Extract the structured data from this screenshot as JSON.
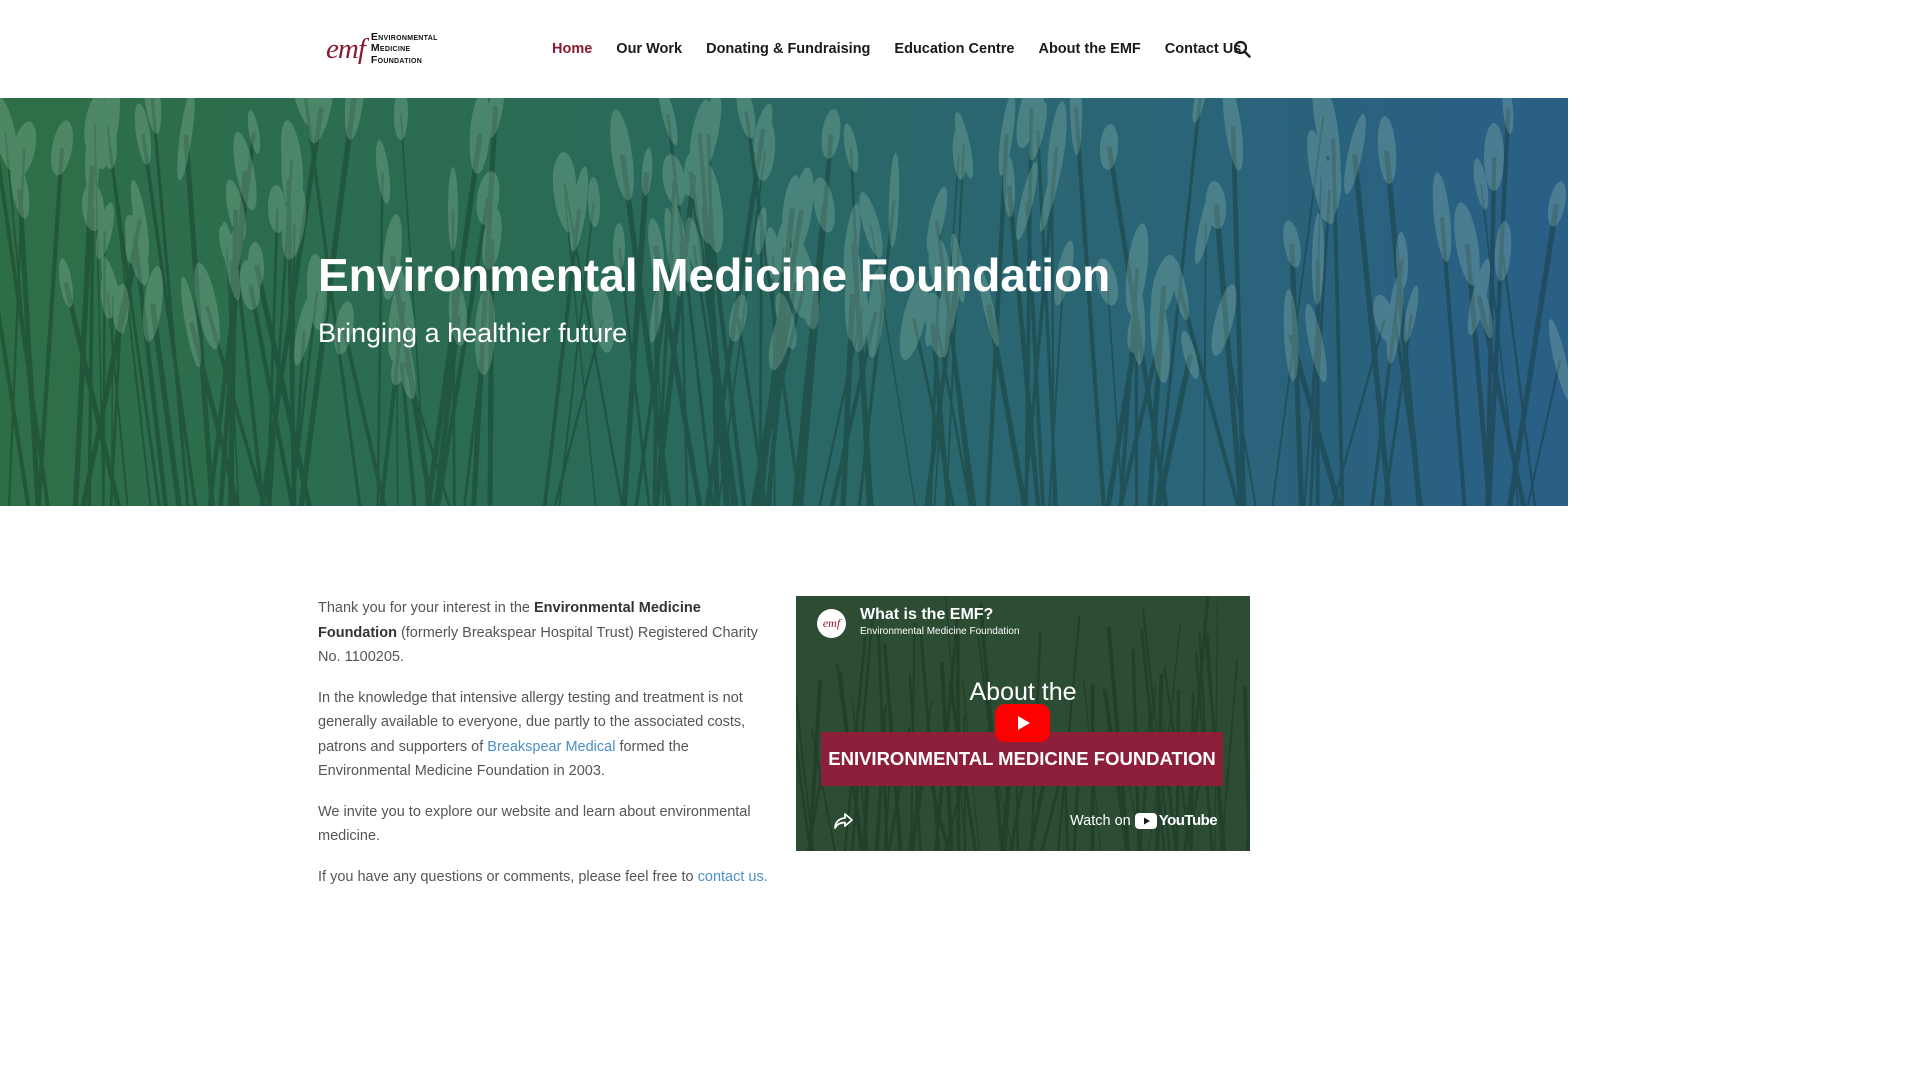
{
  "header": {
    "logo": {
      "mark": "emf",
      "line1": "Environmental",
      "line2": "Medicine",
      "line3": "Foundation"
    },
    "nav": [
      {
        "label": "Home",
        "active": true
      },
      {
        "label": "Our Work"
      },
      {
        "label": "Donating & Fundraising"
      },
      {
        "label": "Education Centre"
      },
      {
        "label": "About the EMF"
      },
      {
        "label": "Contact Us"
      }
    ],
    "search_icon": "search-icon"
  },
  "hero": {
    "title": "Environmental Medicine Foundation",
    "subtitle": "Bringing a healthier future"
  },
  "content": {
    "p1_prefix": "Thank you for your interest in the ",
    "p1_bold": "Environmental Medicine Foundation",
    "p1_suffix": " (formerly Breakspear Hospital Trust) Registered Charity No. 1100205.",
    "p2_prefix": "In the knowledge that intensive allergy testing and treatment is not generally available to everyone, due partly to the associated costs, patrons and supporters of ",
    "p2_link": "Breakspear Medical",
    "p2_suffix": " formed the Environmental Medicine Foundation in 2003.",
    "p3": "We invite you to explore our website and learn about environmental medicine.",
    "p4_prefix": "If you have any questions or comments, please feel free to ",
    "p4_link": "contact us."
  },
  "video": {
    "avatar": "emf",
    "title": "What is the EMF?",
    "channel": "Environmental Medicine Foundation",
    "about": "About the",
    "banner": "ENIVIRONMENTAL MEDICINE FOUNDATION",
    "watch_on": "Watch on",
    "youtube": "YouTube"
  },
  "colors": {
    "brand": "#8a1a2e",
    "link": "#4a90c4",
    "youtube_red": "#ff0000"
  }
}
